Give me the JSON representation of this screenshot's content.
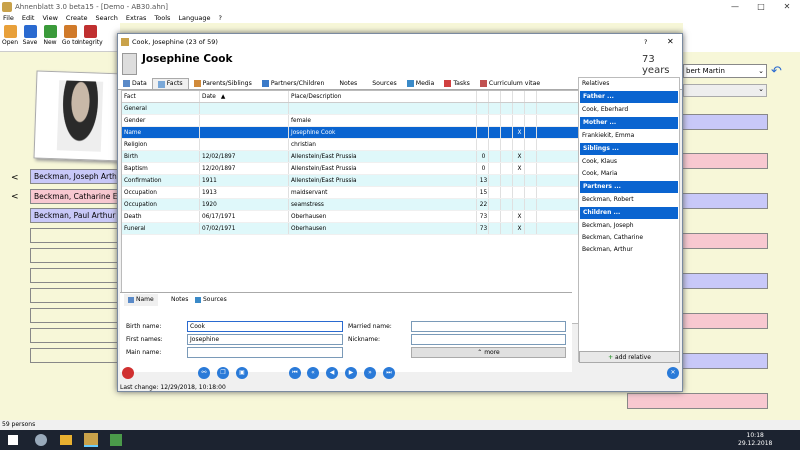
{
  "app": {
    "title": "Ahnenblatt 3.0 beta15 - [Demo - AB30.ahn]",
    "window_controls": [
      "—",
      "□",
      "✕"
    ]
  },
  "menu": [
    "File",
    "Edit",
    "View",
    "Create",
    "Search",
    "Extras",
    "Tools",
    "Language",
    "?"
  ],
  "toolbar": [
    {
      "label": "Open",
      "icon": "folder-open-icon",
      "color": "#e8a03a"
    },
    {
      "label": "Save",
      "icon": "save-icon",
      "color": "#2a6ad0"
    },
    {
      "label": "New",
      "icon": "new-person-icon",
      "color": "#3a9a3a"
    },
    {
      "label": "Go to",
      "icon": "goto-person-icon",
      "color": "#d07a2a"
    },
    {
      "label": "Integrity",
      "icon": "integrity-icon",
      "color": "#c03030"
    }
  ],
  "background": {
    "left_persons": [
      "Beckman, Joseph Arthur",
      "Beckman, Catharine E",
      "Beckman, Paul Arthur"
    ],
    "right_combo": "bert Martin"
  },
  "dialog": {
    "title": "Cook, Josephine (23 of 59)",
    "help": "?",
    "close": "✕",
    "name": "Josephine Cook",
    "age": "73 years",
    "tabs": [
      "Data",
      "Facts",
      "Parents/Siblings",
      "Partners/Children",
      "Notes",
      "Sources",
      "Media",
      "Tasks",
      "Curriculum vitae"
    ],
    "columns": {
      "fact": "Fact",
      "date": "Date",
      "place": "Place/Description"
    },
    "facts": [
      {
        "fact": "General",
        "date": "",
        "place": "",
        "n": "",
        "x": ""
      },
      {
        "fact": "Gender",
        "date": "",
        "place": "female",
        "n": "",
        "x": ""
      },
      {
        "fact": "Name",
        "date": "",
        "place": "Josephine Cook",
        "n": "",
        "x": "X"
      },
      {
        "fact": "Religion",
        "date": "",
        "place": "christian",
        "n": "",
        "x": ""
      },
      {
        "fact": "Birth",
        "date": "12/02/1897",
        "place": "Allenstein/East Prussia",
        "n": "0",
        "x": "X"
      },
      {
        "fact": "Baptism",
        "date": "12/20/1897",
        "place": "Allenstein/East Prussia",
        "n": "0",
        "x": "X"
      },
      {
        "fact": "Confirmation",
        "date": "1911",
        "place": "Allenstein/East Prussia",
        "n": "13",
        "x": ""
      },
      {
        "fact": "Occupation",
        "date": "1913",
        "place": "maidservant",
        "n": "15",
        "x": ""
      },
      {
        "fact": "Occupation",
        "date": "1920",
        "place": "seamstress",
        "n": "22",
        "x": ""
      },
      {
        "fact": "Death",
        "date": "06/17/1971",
        "place": "Oberhausen",
        "n": "73",
        "x": "X"
      },
      {
        "fact": "Funeral",
        "date": "07/02/1971",
        "place": "Oberhausen",
        "n": "73",
        "x": "X"
      }
    ],
    "bottom_tabs": [
      "Name",
      "Notes",
      "Sources"
    ],
    "fields": {
      "birth_name_label": "Birth name:",
      "birth_name": "Cook",
      "first_names_label": "First names:",
      "first_names": "Josephine",
      "main_name_label": "Main name:",
      "main_name": "",
      "married_name_label": "Married name:",
      "married_name": "",
      "nickname_label": "Nickname:",
      "nickname": "",
      "more": "more"
    },
    "relatives": {
      "header": "Relatives",
      "groups": [
        {
          "title": "Father ...",
          "people": [
            "Cook, Eberhard"
          ]
        },
        {
          "title": "Mother ...",
          "people": [
            "Frankiekit, Emma"
          ]
        },
        {
          "title": "Siblings ...",
          "people": [
            "Cook, Klaus",
            "Cook, Maria"
          ]
        },
        {
          "title": "Partners ...",
          "people": [
            "Beckman, Robert"
          ]
        },
        {
          "title": "Children ...",
          "people": [
            "Beckman, Joseph",
            "Beckman, Catharine",
            "Beckman, Arthur"
          ]
        }
      ],
      "add": "add relative"
    },
    "last_change": "Last change: 12/29/2018, 10:18:00"
  },
  "status": "59 persons",
  "clock": {
    "time": "10:18",
    "date": "29.12.2018"
  },
  "colors": {
    "selected": "#0a64d0",
    "alt_row": "#dff8fa",
    "person_blue": "#c8c8f8",
    "person_pink": "#f8c8d0"
  }
}
